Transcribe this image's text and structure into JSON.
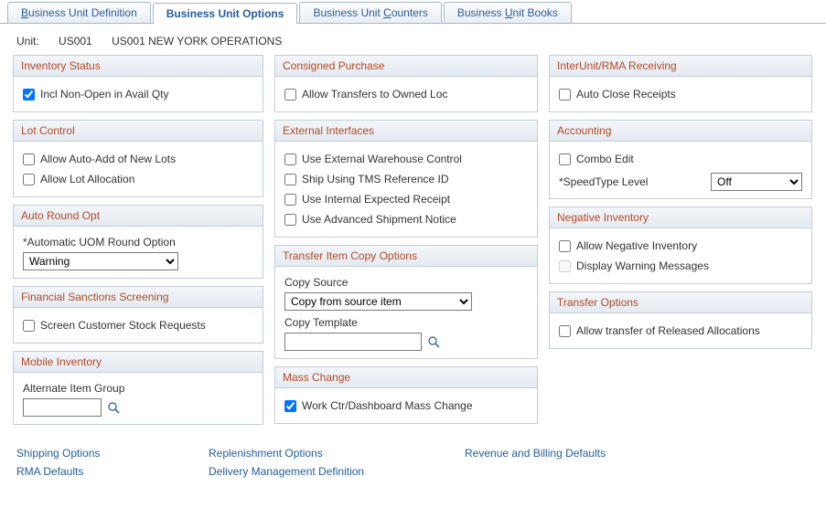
{
  "tabs": {
    "definition": "usiness Unit Definition",
    "definition_prefix": "B",
    "options": "Business Unit Options",
    "counters_a": "Business Unit ",
    "counters_u": "C",
    "counters_b": "ounters",
    "books_a": "Business ",
    "books_u": "U",
    "books_b": "nit Books"
  },
  "unit": {
    "label": "Unit:",
    "code": "US001",
    "name": "US001 NEW YORK OPERATIONS"
  },
  "col1": {
    "inventory_status": {
      "header": "Inventory Status",
      "incl_non_open": "Incl Non-Open in Avail Qty"
    },
    "lot_control": {
      "header": "Lot Control",
      "auto_add": "Allow Auto-Add of New Lots",
      "allocation": "Allow Lot Allocation"
    },
    "auto_round": {
      "header": "Auto Round Opt",
      "label": "*Automatic UOM Round Option",
      "value": "Warning"
    },
    "fss": {
      "header": "Financial Sanctions Screening",
      "screen": "Screen Customer Stock Requests"
    },
    "mobile": {
      "header": "Mobile Inventory",
      "label": "Alternate Item Group",
      "value": ""
    }
  },
  "col2": {
    "consigned": {
      "header": "Consigned Purchase",
      "allow": "Allow Transfers to Owned Loc"
    },
    "external": {
      "header": "External Interfaces",
      "ewc": "Use External Warehouse Control",
      "tms": "Ship Using TMS Reference ID",
      "ier": "Use Internal Expected Receipt",
      "asn": "Use Advanced Shipment Notice"
    },
    "transfer_copy": {
      "header": "Transfer Item Copy Options",
      "copy_source_label": "Copy Source",
      "copy_source_value": "Copy from source item",
      "copy_template_label": "Copy Template",
      "copy_template_value": ""
    },
    "mass": {
      "header": "Mass Change",
      "work_ctr": "Work Ctr/Dashboard Mass Change"
    }
  },
  "col3": {
    "interunit": {
      "header": "InterUnit/RMA Receiving",
      "auto_close": "Auto Close Receipts"
    },
    "accounting": {
      "header": "Accounting",
      "combo_edit": "Combo Edit",
      "speedtype_label": "*SpeedType Level",
      "speedtype_value": "Off"
    },
    "neg_inv": {
      "header": "Negative Inventory",
      "allow": "Allow Negative Inventory",
      "display": "Display Warning Messages"
    },
    "transfer_opts": {
      "header": "Transfer Options",
      "allow_released": "Allow transfer of Released Allocations"
    }
  },
  "links": {
    "shipping": "Shipping Options",
    "replenish": "Replenishment Options",
    "revenue": "Revenue and Billing Defaults",
    "rma": "RMA Defaults",
    "delivery": "Delivery Management Definition"
  }
}
